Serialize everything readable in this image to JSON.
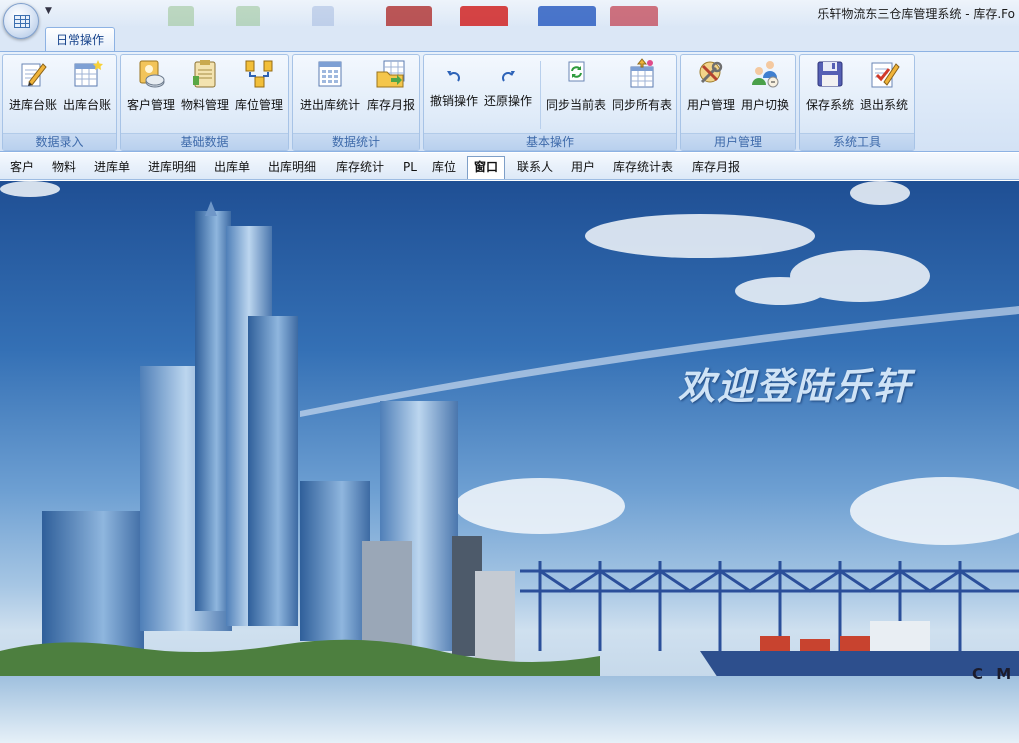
{
  "window": {
    "title": "乐轩物流东三仓库管理系统 - 库存.Fo"
  },
  "ribbon": {
    "active_tab": "日常操作",
    "groups": [
      {
        "label": "数据录入",
        "buttons": [
          {
            "label": "进库台账",
            "icon": "ledger-in-icon"
          },
          {
            "label": "出库台账",
            "icon": "ledger-out-icon"
          }
        ]
      },
      {
        "label": "基础数据",
        "buttons": [
          {
            "label": "客户管理",
            "icon": "customer-icon"
          },
          {
            "label": "物料管理",
            "icon": "material-icon"
          },
          {
            "label": "库位管理",
            "icon": "location-icon"
          }
        ]
      },
      {
        "label": "数据统计",
        "buttons": [
          {
            "label": "进出库统计",
            "icon": "stats-table-icon"
          },
          {
            "label": "库存月报",
            "icon": "monthly-report-icon"
          }
        ]
      },
      {
        "label": "基本操作",
        "buttons": [
          {
            "label": "撤销操作",
            "icon": "undo-icon"
          },
          {
            "label": "还原操作",
            "icon": "redo-icon"
          },
          {
            "label": "同步当前表",
            "icon": "sync-current-icon"
          },
          {
            "label": "同步所有表",
            "icon": "sync-all-icon"
          }
        ]
      },
      {
        "label": "用户管理",
        "buttons": [
          {
            "label": "用户管理",
            "icon": "user-tools-icon"
          },
          {
            "label": "用户切换",
            "icon": "switch-user-icon"
          }
        ]
      },
      {
        "label": "系统工具",
        "buttons": [
          {
            "label": "保存系统",
            "icon": "save-disk-icon"
          },
          {
            "label": "退出系统",
            "icon": "exit-icon"
          }
        ]
      }
    ]
  },
  "doc_tabs": {
    "active": "窗口",
    "items": [
      "客户",
      "物料",
      "进库单",
      "进库明细",
      "出库单",
      "出库明细",
      "库存统计",
      "PL",
      "库位",
      "窗口",
      "联系人",
      "用户",
      "库存统计表",
      "库存月报"
    ]
  },
  "welcome": {
    "text": "欢迎登陆乐轩",
    "ship_text": "C M"
  },
  "colors": {
    "ribbon_text": "#15428b",
    "group_label": "#3e6aaa",
    "welcome_text": "#cfe3f6"
  }
}
